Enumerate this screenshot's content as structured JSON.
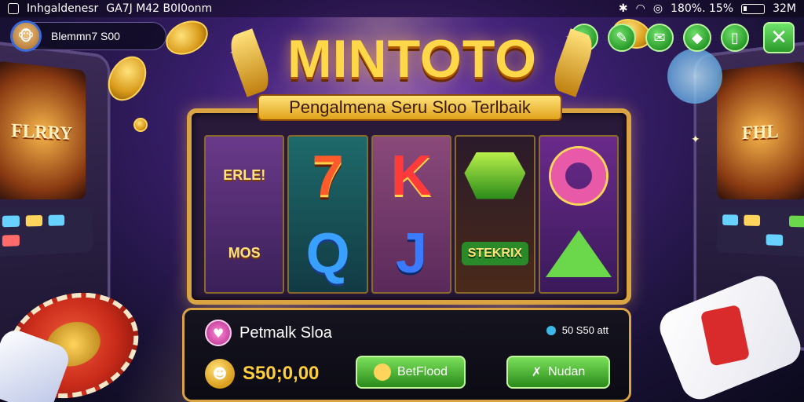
{
  "status_bar": {
    "app_name": "Inhgaldenesr",
    "time": "GA7J M42 B0I0onm",
    "battery_pct": "180%. 15%",
    "signal": "32M"
  },
  "profile": {
    "name": "Blemmn7 S00"
  },
  "title": {
    "main": "MINTOTO",
    "subtitle": "Pengalmena Seru Sloo Terlbaik"
  },
  "machines": {
    "left_screen": "FLRRY",
    "right_screen": "FHL"
  },
  "reels": [
    {
      "top": "ERLE!",
      "bottom": "MOS"
    },
    {
      "top": "7",
      "bottom": "Q"
    },
    {
      "top": "K",
      "bottom": "J"
    },
    {
      "top": "gem",
      "bottom": "STEKRIX"
    },
    {
      "top": "donut",
      "bottom": "pyramid"
    }
  ],
  "bottom_panel": {
    "label": "Petmalk Sloa",
    "info": "50 S50 att",
    "balance": "S50;0,00",
    "bet_button": "BetFlood",
    "spin_button": "Nudan"
  },
  "colors": {
    "accent_gold": "#d9a441",
    "button_green": "#2a9a2a"
  },
  "icons": [
    "avatar",
    "tool-icon",
    "edit-icon",
    "mail-icon",
    "shield-icon",
    "book-icon",
    "close-icon"
  ]
}
